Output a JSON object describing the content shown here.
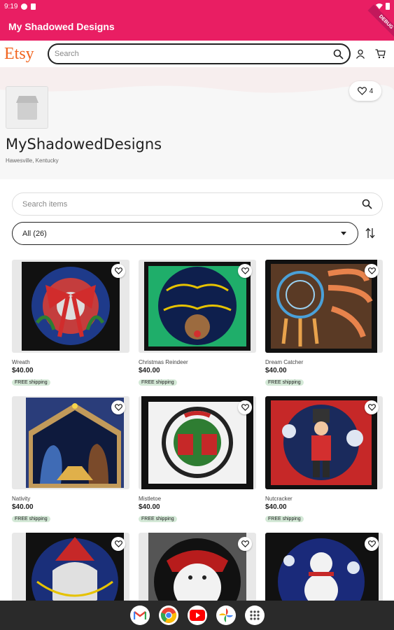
{
  "status": {
    "time": "9:19"
  },
  "app": {
    "title": "My Shadowed Designs",
    "debug_label": "DEBUG"
  },
  "etsy": {
    "logo": "Etsy",
    "search_placeholder": "Search"
  },
  "shop": {
    "favorites_count": "4",
    "name": "MyShadowedDesigns",
    "location": "Hawesville, Kentucky"
  },
  "items_search": {
    "placeholder": "Search items"
  },
  "filter": {
    "selected": "All (26)"
  },
  "listings": [
    {
      "title": "Wreath",
      "price": "$40.00",
      "shipping": "FREE shipping"
    },
    {
      "title": "Christmas Reindeer",
      "price": "$40.00",
      "shipping": "FREE shipping"
    },
    {
      "title": "Dream Catcher",
      "price": "$40.00",
      "shipping": "FREE shipping"
    },
    {
      "title": "Nativity",
      "price": "$40.00",
      "shipping": "FREE shipping"
    },
    {
      "title": "Mistletoe",
      "price": "$40.00",
      "shipping": "FREE shipping"
    },
    {
      "title": "Nutcracker",
      "price": "$40.00",
      "shipping": "FREE shipping"
    },
    {
      "title": "",
      "price": "",
      "shipping": ""
    },
    {
      "title": "",
      "price": "",
      "shipping": ""
    },
    {
      "title": "",
      "price": "",
      "shipping": ""
    }
  ],
  "colors": {
    "accent": "#e91e63",
    "etsy_orange": "#f1641e",
    "nav_bg": "#2a2a2a"
  },
  "dock": [
    "gmail-icon",
    "chrome-icon",
    "youtube-icon",
    "photos-icon",
    "apps-icon"
  ]
}
